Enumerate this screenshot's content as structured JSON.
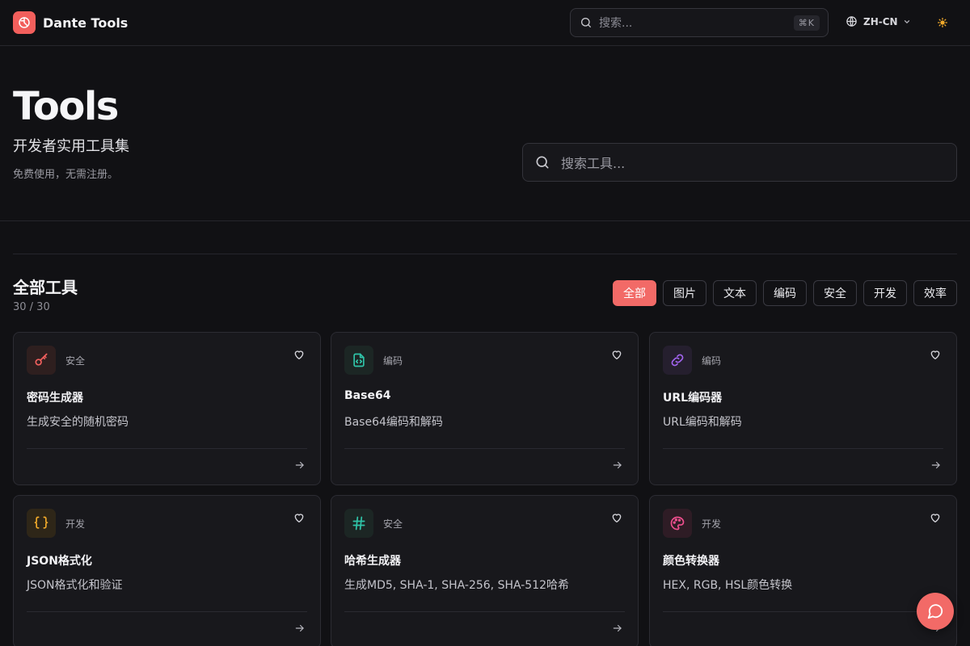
{
  "header": {
    "brand": "Dante Tools",
    "search_placeholder": "搜索...",
    "search_shortcut": "⌘K",
    "language": "ZH-CN"
  },
  "hero": {
    "title": "Tools",
    "subtitle": "开发者实用工具集",
    "note": "免费使用，无需注册。",
    "search_placeholder": "搜索工具..."
  },
  "section": {
    "title": "全部工具",
    "count": "30 / 30",
    "filters": [
      "全部",
      "图片",
      "文本",
      "编码",
      "安全",
      "开发",
      "效率"
    ],
    "active_filter": "全部"
  },
  "tools": [
    {
      "name": "密码生成器",
      "category": "安全",
      "description": "生成安全的随机密码",
      "icon": "key-icon",
      "color": "#f2605e"
    },
    {
      "name": "Base64",
      "category": "编码",
      "description": "Base64编码和解码",
      "icon": "file-code-icon",
      "color": "#2fc4a8"
    },
    {
      "name": "URL编码器",
      "category": "编码",
      "description": "URL编码和解码",
      "icon": "link-icon",
      "color": "#a364f0"
    },
    {
      "name": "JSON格式化",
      "category": "开发",
      "description": "JSON格式化和验证",
      "icon": "braces-icon",
      "color": "#f0a92a"
    },
    {
      "name": "哈希生成器",
      "category": "安全",
      "description": "生成MD5, SHA-1, SHA-256, SHA-512哈希",
      "icon": "hash-icon",
      "color": "#2fc4a8"
    },
    {
      "name": "颜色转换器",
      "category": "开发",
      "description": "HEX, RGB, HSL颜色转换",
      "icon": "palette-icon",
      "color": "#ef4f8e"
    }
  ],
  "colors": {
    "accent": "#f26a67",
    "background": "#111114",
    "card": "#18181c"
  }
}
